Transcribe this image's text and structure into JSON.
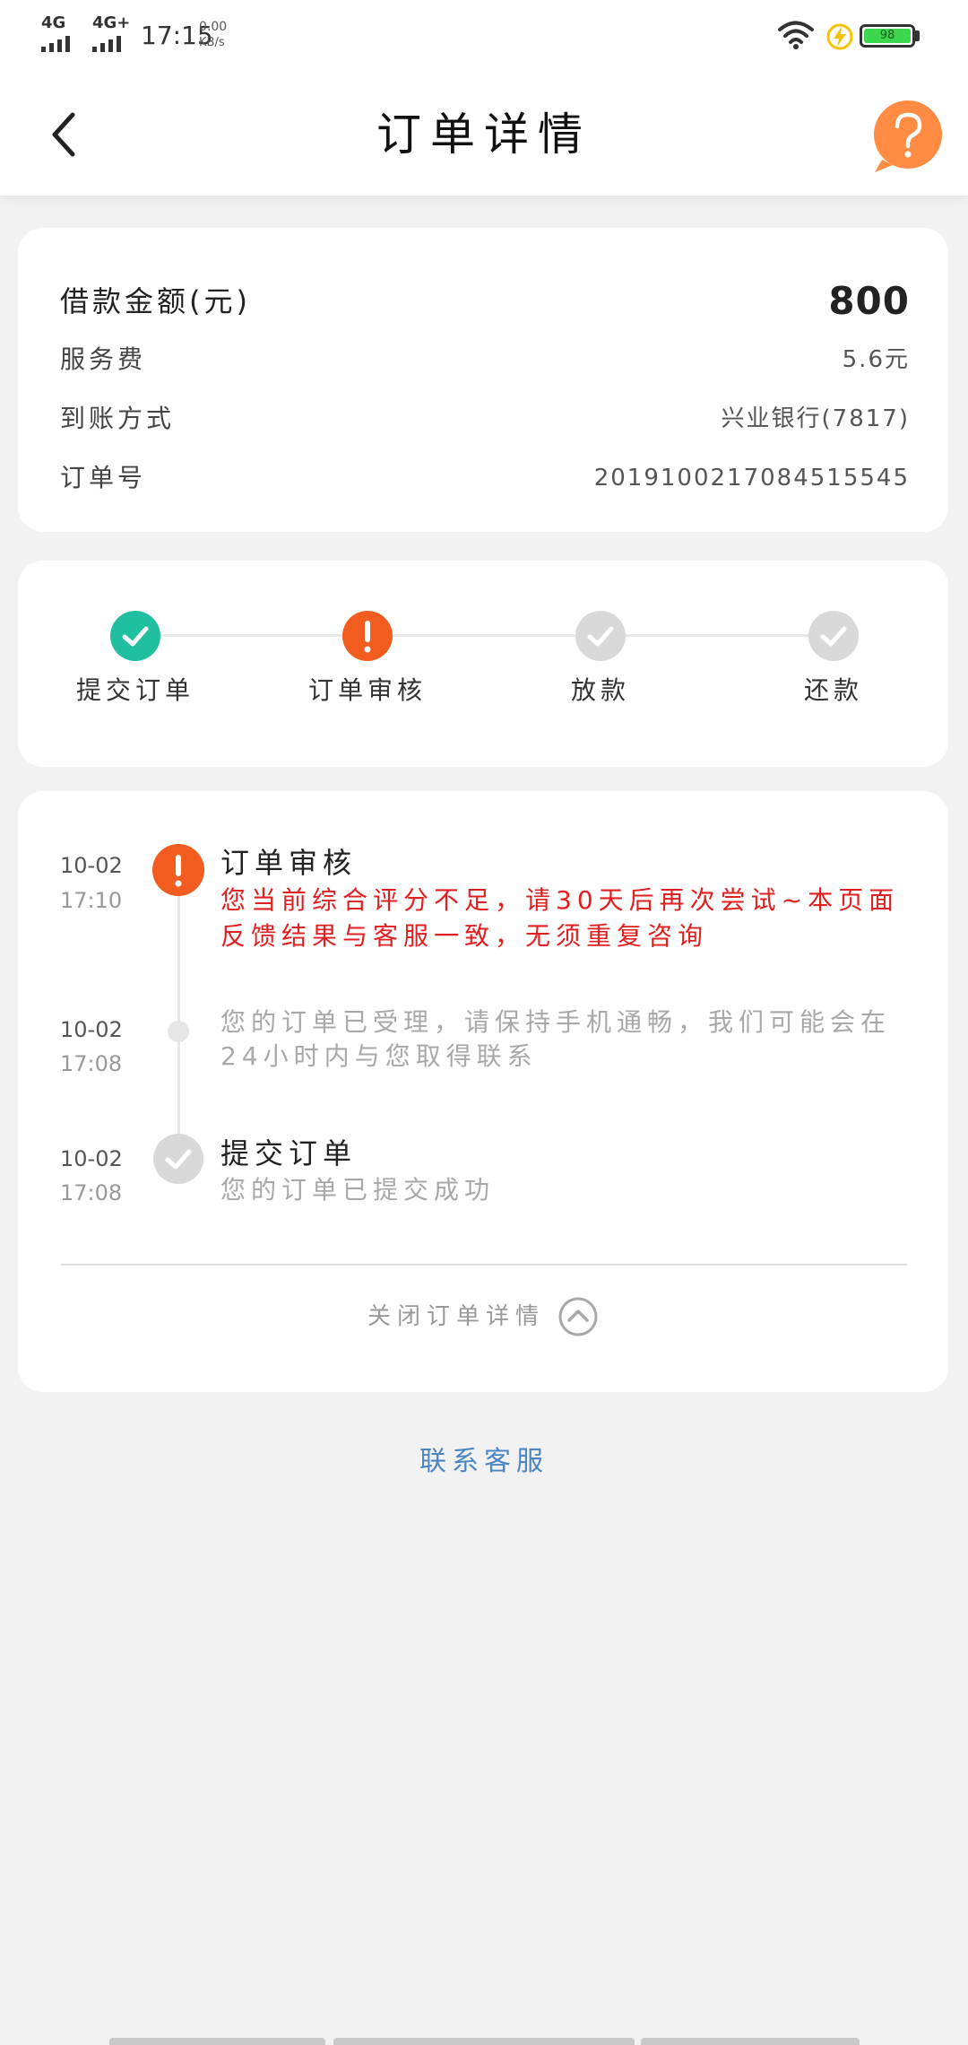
{
  "status_bar": {
    "network1": "4G",
    "network2": "4G+",
    "time": "17:15",
    "speed_value": "0.00",
    "speed_unit": "KB/s",
    "battery": "98",
    "icons": [
      "signal-icon",
      "wifi-icon",
      "charging-icon",
      "battery-icon"
    ]
  },
  "header": {
    "title": "订单详情",
    "back_icon": "chevron-left-icon",
    "help_icon": "question-bubble-icon"
  },
  "summary": {
    "rows": [
      {
        "label": "借款金额(元)",
        "value": "800"
      },
      {
        "label": "服务费",
        "value": "5.6元"
      },
      {
        "label": "到账方式",
        "value": "兴业银行(7817)"
      },
      {
        "label": "订单号",
        "value": "2019100217084515545"
      }
    ]
  },
  "progress": {
    "steps": [
      {
        "label": "提交订单",
        "status": "done"
      },
      {
        "label": "订单审核",
        "status": "alert"
      },
      {
        "label": "放款",
        "status": "pending"
      },
      {
        "label": "还款",
        "status": "pending"
      }
    ]
  },
  "timeline": {
    "items": [
      {
        "date": "10-02",
        "time": "17:10",
        "title": "订单审核",
        "text": "您当前综合评分不足，请30天后再次尝试~本页面反馈结果与客服一致，无须重复咨询",
        "status": "alert"
      },
      {
        "date": "10-02",
        "time": "17:08",
        "text": "您的订单已受理，请保持手机通畅，我们可能会在24小时内与您取得联系",
        "status": "dot"
      },
      {
        "date": "10-02",
        "time": "17:08",
        "title": "提交订单",
        "text": "您的订单已提交成功",
        "status": "done"
      }
    ],
    "collapse_label": "关闭订单详情",
    "collapse_icon": "chevron-up-circle-icon"
  },
  "contact_label": "联系客服",
  "colors": {
    "done": "#1fbfa0",
    "alert": "#f25c1e",
    "pending": "#d9d9d9",
    "alert_text": "#e02020",
    "help": "#ff8c42",
    "link": "#4a86c5",
    "battery": "#3dd64f"
  }
}
